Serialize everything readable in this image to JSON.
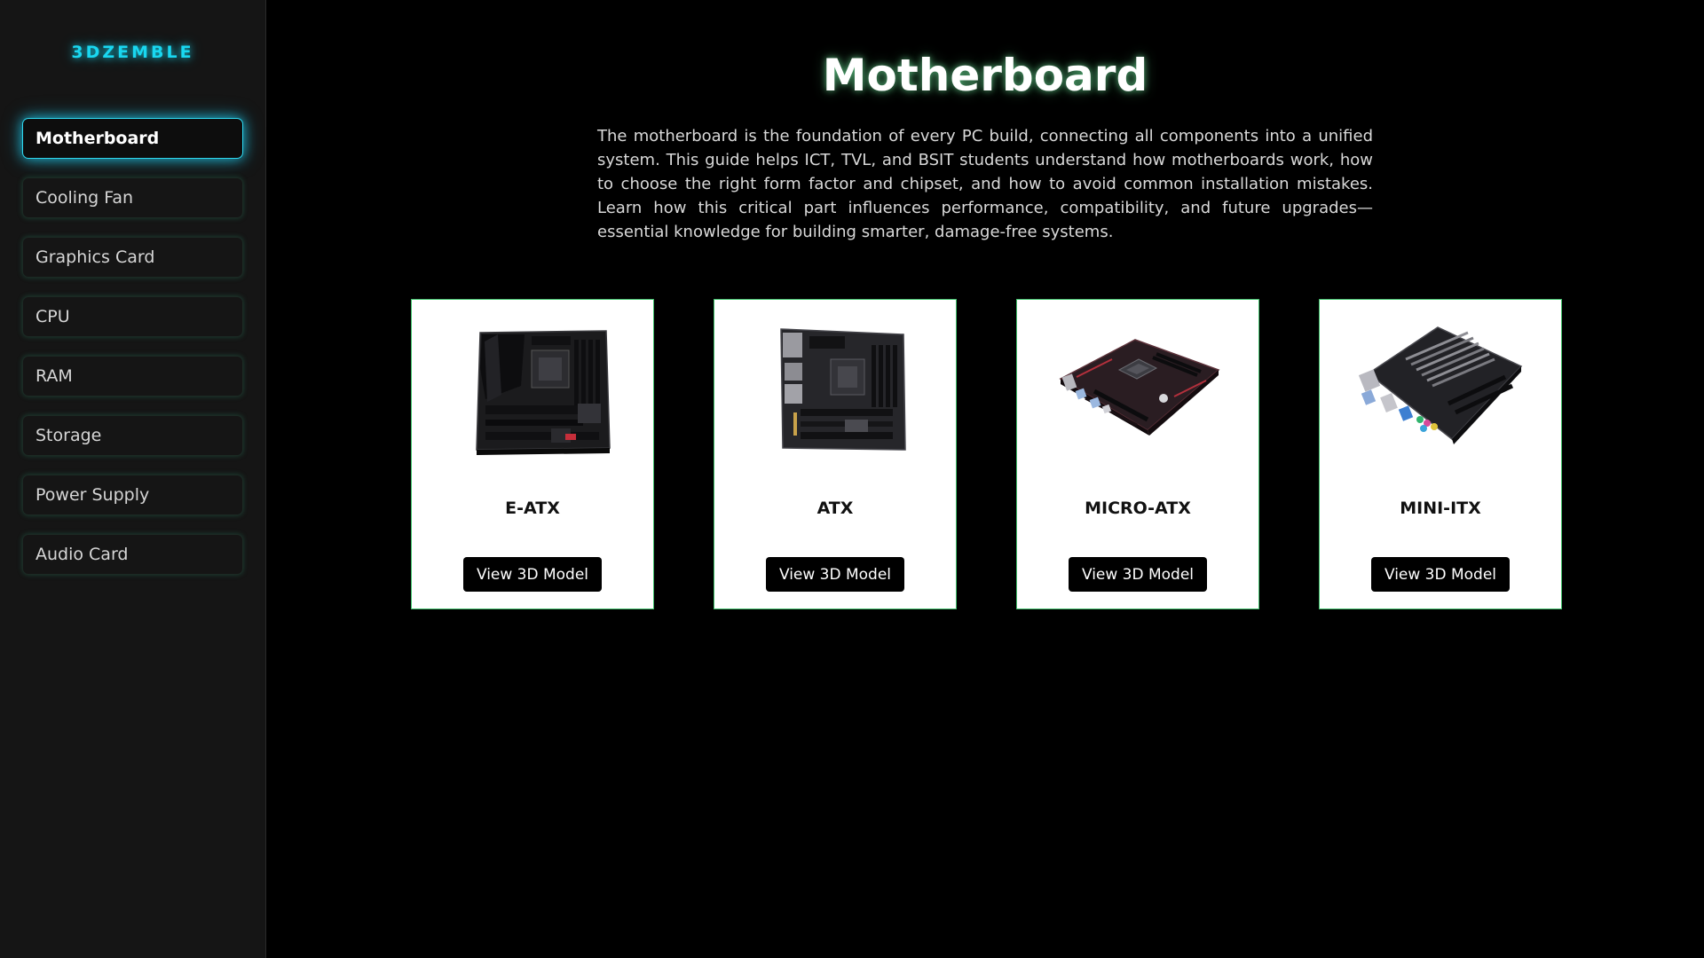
{
  "brand": "3DZEMBLE",
  "sidebar": {
    "items": [
      {
        "label": "Motherboard",
        "active": true
      },
      {
        "label": "Cooling Fan",
        "active": false
      },
      {
        "label": "Graphics Card",
        "active": false
      },
      {
        "label": "CPU",
        "active": false
      },
      {
        "label": "RAM",
        "active": false
      },
      {
        "label": "Storage",
        "active": false
      },
      {
        "label": "Power Supply",
        "active": false
      },
      {
        "label": "Audio Card",
        "active": false
      }
    ]
  },
  "main": {
    "title": "Motherboard",
    "description": "The motherboard is the foundation of every PC build, connecting all components into a unified system. This guide helps ICT, TVL, and BSIT students understand how motherboards work, how to choose the right form factor and chipset, and how to avoid common installation mistakes. Learn how this critical part influences performance, compatibility, and future upgrades—essential knowledge for building smarter, damage-free systems.",
    "cards": [
      {
        "name": "E-ATX",
        "button": "View 3D Model",
        "image": "motherboard-eatx-image"
      },
      {
        "name": "ATX",
        "button": "View 3D Model",
        "image": "motherboard-atx-image"
      },
      {
        "name": "MICRO-ATX",
        "button": "View 3D Model",
        "image": "motherboard-micro-atx-image"
      },
      {
        "name": "MINI-ITX",
        "button": "View 3D Model",
        "image": "motherboard-mini-itx-image"
      }
    ]
  },
  "colors": {
    "accent_cyan": "#19d7f0",
    "sidebar_bg": "#151515",
    "page_bg": "#000000",
    "card_border": "#3fbf6a"
  }
}
